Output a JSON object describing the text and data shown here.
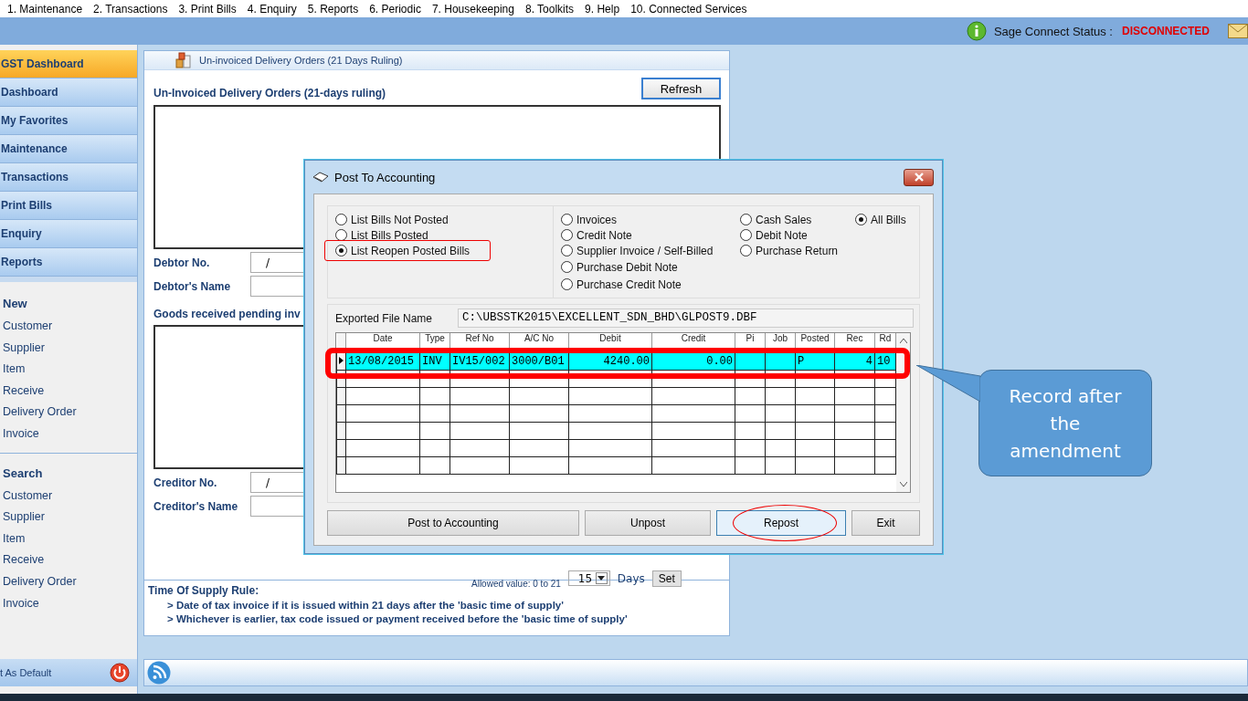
{
  "menu": [
    "1. Maintenance",
    "2. Transactions",
    "3. Print Bills",
    "4. Enquiry",
    "5. Reports",
    "6. Periodic",
    "7. Housekeeping",
    "8. Toolkits",
    "9. Help",
    "10. Connected Services"
  ],
  "connect_status": {
    "label": "Sage Connect Status :",
    "value": "DISCONNECTED"
  },
  "sidebar": {
    "nav": [
      {
        "label": "GST Dashboard",
        "selected": true
      },
      {
        "label": "Dashboard",
        "selected": false
      },
      {
        "label": "My Favorites",
        "selected": false
      },
      {
        "label": "Maintenance",
        "selected": false
      },
      {
        "label": "Transactions",
        "selected": false
      },
      {
        "label": "Print Bills",
        "selected": false
      },
      {
        "label": "Enquiry",
        "selected": false
      },
      {
        "label": "Reports",
        "selected": false
      }
    ],
    "sections": [
      {
        "title": "New",
        "items": [
          "Customer",
          "Supplier",
          "Item",
          "Receive",
          "Delivery Order",
          "Invoice"
        ]
      },
      {
        "title": "Search",
        "items": [
          "Customer",
          "Supplier",
          "Item",
          "Receive",
          "Delivery Order",
          "Invoice"
        ]
      }
    ],
    "footer": "t As Default"
  },
  "panel": {
    "tab_title": "Un-invoiced Delivery Orders (21 Days Ruling)",
    "heading": "Un-Invoiced Delivery Orders (21-days ruling)",
    "refresh": "Refresh",
    "debtor_no_label": "Debtor No.",
    "debtor_no": "/",
    "debtor_name_label": "Debtor's Name",
    "goods_heading": "Goods received pending inv",
    "creditor_no_label": "Creditor No.",
    "creditor_no": "/",
    "creditor_name_label": "Creditor's Name",
    "threshold": {
      "allowed": "Allowed value: 0 to 21",
      "value": "15",
      "unit": "Days",
      "button": "Set"
    },
    "rule": {
      "title": "Time Of Supply Rule:",
      "lines": [
        "> Date of tax invoice if it is issued within 21 days after the 'basic time of supply'",
        "> Whichever is earlier, tax code issued or payment received before the 'basic time of supply'"
      ]
    }
  },
  "dialog": {
    "title": "Post To Accounting",
    "list_options": [
      {
        "label": "List Bills Not Posted",
        "selected": false,
        "annotated": false
      },
      {
        "label": "List Bills Posted",
        "selected": false,
        "annotated": false
      },
      {
        "label": "List Reopen Posted Bills",
        "selected": true,
        "annotated": true
      }
    ],
    "bill_types": [
      {
        "label": "Invoices",
        "selected": false
      },
      {
        "label": "Credit Note",
        "selected": false
      },
      {
        "label": "Supplier Invoice / Self-Billed",
        "selected": false
      },
      {
        "label": "Purchase Debit Note",
        "selected": false
      },
      {
        "label": "Purchase Credit Note",
        "selected": false
      },
      {
        "label": "Cash Sales",
        "selected": false
      },
      {
        "label": "Debit Note",
        "selected": false
      },
      {
        "label": "Purchase Return",
        "selected": false
      },
      {
        "label": "All Bills",
        "selected": true
      }
    ],
    "file_label": "Exported File Name",
    "file_name": "C:\\UBSSTK2015\\EXCELLENT_SDN_BHD\\GLPOST9.DBF",
    "grid": {
      "columns": [
        "Date",
        "Type",
        "Ref No",
        "A/C No",
        "Debit",
        "Credit",
        "Pi",
        "Job",
        "Posted",
        "Rec",
        "Rd"
      ],
      "rows": [
        {
          "cells": [
            "13/08/2015",
            "INV",
            "IV15/002",
            "3000/B01",
            "4240.00",
            "0.00",
            "",
            "",
            "P",
            "4",
            "10"
          ],
          "selected": true,
          "annotated": true
        }
      ]
    },
    "buttons": [
      {
        "label": "Post to Accounting",
        "annotated": false
      },
      {
        "label": "Unpost",
        "annotated": false
      },
      {
        "label": "Repost",
        "annotated": true
      },
      {
        "label": "Exit",
        "annotated": false
      }
    ]
  },
  "callout": "Record after the amendment"
}
